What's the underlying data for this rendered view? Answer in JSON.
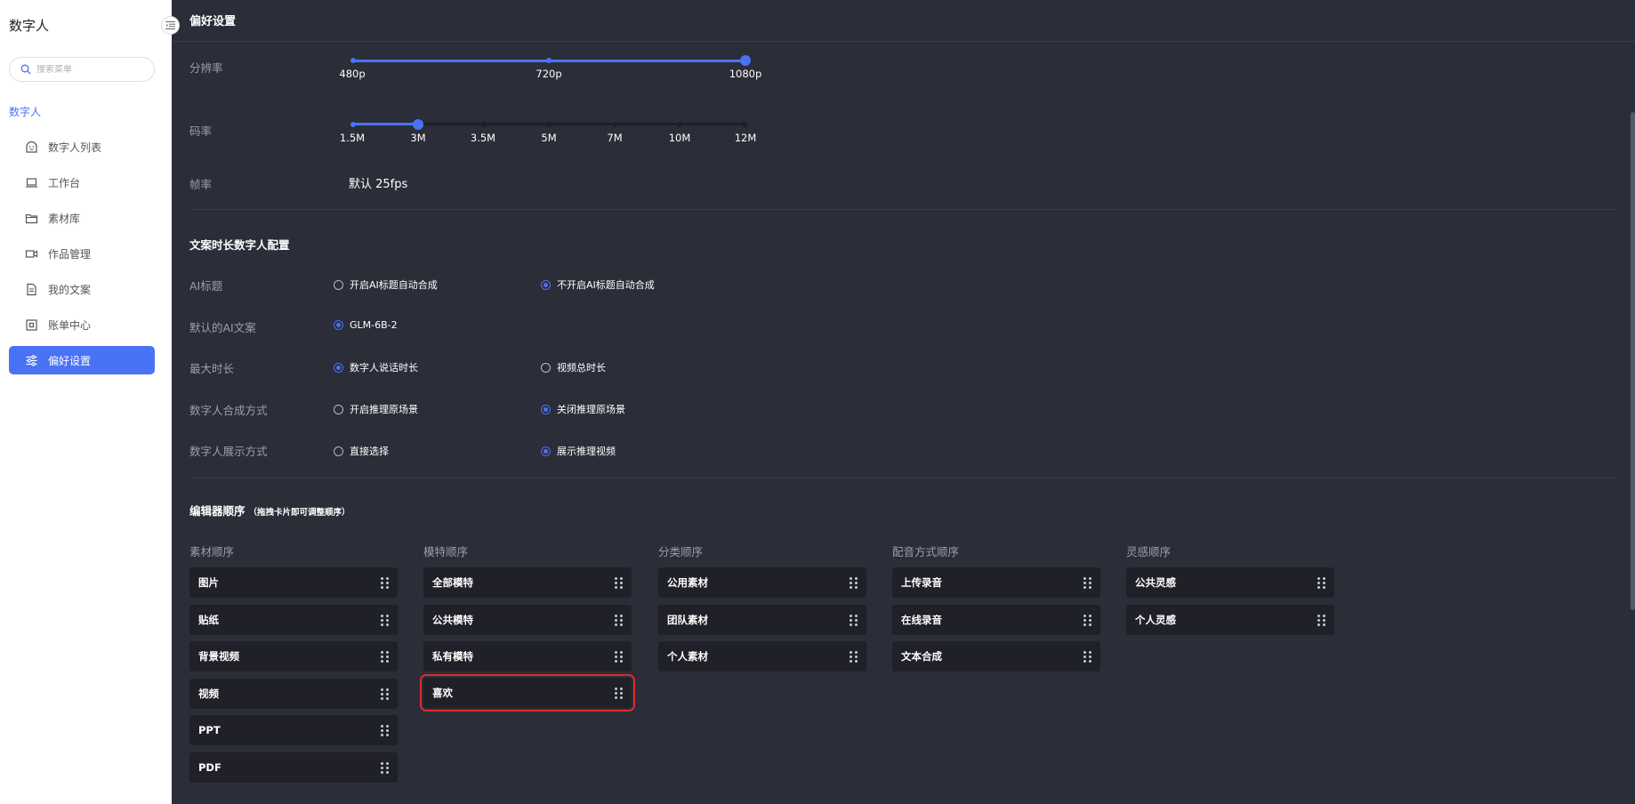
{
  "sidebar": {
    "app_title": "数字人",
    "search_placeholder": "搜索菜单",
    "group_label": "数字人",
    "items": [
      {
        "label": "数字人列表",
        "icon": "digital-human-icon",
        "active": false
      },
      {
        "label": "工作台",
        "icon": "laptop-icon",
        "active": false
      },
      {
        "label": "素材库",
        "icon": "folder-icon",
        "active": false
      },
      {
        "label": "作品管理",
        "icon": "video-camera-icon",
        "active": false
      },
      {
        "label": "我的文案",
        "icon": "document-icon",
        "active": false
      },
      {
        "label": "账单中心",
        "icon": "bill-icon",
        "active": false
      },
      {
        "label": "偏好设置",
        "icon": "sliders-icon",
        "active": true
      }
    ]
  },
  "header": {
    "title": "偏好设置"
  },
  "video_settings": {
    "resolution": {
      "label": "分辨率",
      "options": [
        "480p",
        "720p",
        "1080p"
      ],
      "selected": "1080p"
    },
    "bitrate": {
      "label": "码率",
      "options": [
        "1.5M",
        "3M",
        "3.5M",
        "5M",
        "7M",
        "10M",
        "12M"
      ],
      "selected": "3M"
    },
    "framerate": {
      "label": "帧率",
      "value": "默认 25fps"
    }
  },
  "copy_config": {
    "title": "文案时长数字人配置",
    "rows": [
      {
        "label": "AI标题",
        "options": [
          {
            "text": "开启AI标题自动合成",
            "checked": false
          },
          {
            "text": "不开启AI标题自动合成",
            "checked": true
          }
        ]
      },
      {
        "label": "默认的AI文案",
        "options": [
          {
            "text": "GLM-6B-2",
            "checked": true
          }
        ]
      },
      {
        "label": "最大时长",
        "options": [
          {
            "text": "数字人说话时长",
            "checked": true
          },
          {
            "text": "视频总时长",
            "checked": false
          }
        ]
      },
      {
        "label": "数字人合成方式",
        "options": [
          {
            "text": "开启推理原场景",
            "checked": false
          },
          {
            "text": "关闭推理原场景",
            "checked": true
          }
        ]
      },
      {
        "label": "数字人展示方式",
        "options": [
          {
            "text": "直接选择",
            "checked": false
          },
          {
            "text": "展示推理视频",
            "checked": true
          }
        ]
      }
    ]
  },
  "editor_order": {
    "title": "编辑器顺序",
    "hint": "（拖拽卡片即可调整顺序）",
    "columns": [
      {
        "title": "素材顺序",
        "cards": [
          "图片",
          "贴纸",
          "背景视频",
          "视频",
          "PPT",
          "PDF"
        ]
      },
      {
        "title": "模特顺序",
        "cards": [
          "全部模特",
          "公共模特",
          "私有模特",
          "喜欢"
        ]
      },
      {
        "title": "分类顺序",
        "cards": [
          "公用素材",
          "团队素材",
          "个人素材"
        ]
      },
      {
        "title": "配音方式顺序",
        "cards": [
          "上传录音",
          "在线录音",
          "文本合成"
        ]
      },
      {
        "title": "灵感顺序",
        "cards": [
          "公共灵感",
          "个人灵感"
        ]
      }
    ],
    "highlighted_card": "喜欢",
    "highlight_color": "#e02a2a"
  },
  "colors": {
    "accent": "#4a72f5",
    "background": "#2b2d38",
    "card": "#1f2028"
  }
}
